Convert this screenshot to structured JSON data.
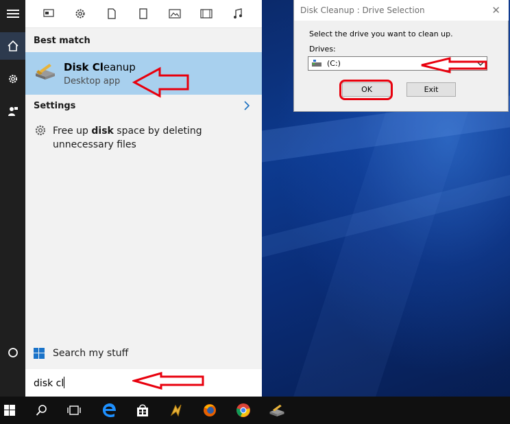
{
  "colors": {
    "accent_highlight": "#a8d0ee",
    "annotation_red": "#e8000d",
    "taskbar": "#101010",
    "rail": "#1f1f1f"
  },
  "rail": {
    "items": [
      "hamburger-icon",
      "home-icon",
      "gear-icon",
      "feedback-icon",
      "cortana-circle-icon"
    ]
  },
  "filters": [
    "apps-icon",
    "settings-icon",
    "documents-icon",
    "folders-icon",
    "photos-icon",
    "videos-icon",
    "music-icon"
  ],
  "start_panel": {
    "best_match_heading": "Best match",
    "best_match": {
      "name_bold": "Disk Cl",
      "name_rest": "eanup",
      "subtitle": "Desktop app",
      "icon": "disk-cleanup-icon"
    },
    "settings_heading": "Settings",
    "setting_item": {
      "text_a": "Free up ",
      "text_bold": "disk",
      "text_b": " space by deleting unnecessary files",
      "icon": "settings-gear-icon"
    },
    "search_my_stuff": "Search my stuff",
    "search_query": "disk cl"
  },
  "dialog": {
    "title": "Disk Cleanup : Drive Selection",
    "close_glyph": "✕",
    "prompt": "Select the drive you want to clean up.",
    "drives_label": "Drives:",
    "drives_value": "(C:)",
    "ok_label": "OK",
    "exit_label": "Exit"
  },
  "taskbar": {
    "items": [
      "windows-start-icon",
      "search-icon",
      "task-view-icon",
      "edge-icon",
      "store-icon",
      "winamp-icon",
      "firefox-icon",
      "chrome-icon",
      "disk-cleanup-icon"
    ]
  }
}
